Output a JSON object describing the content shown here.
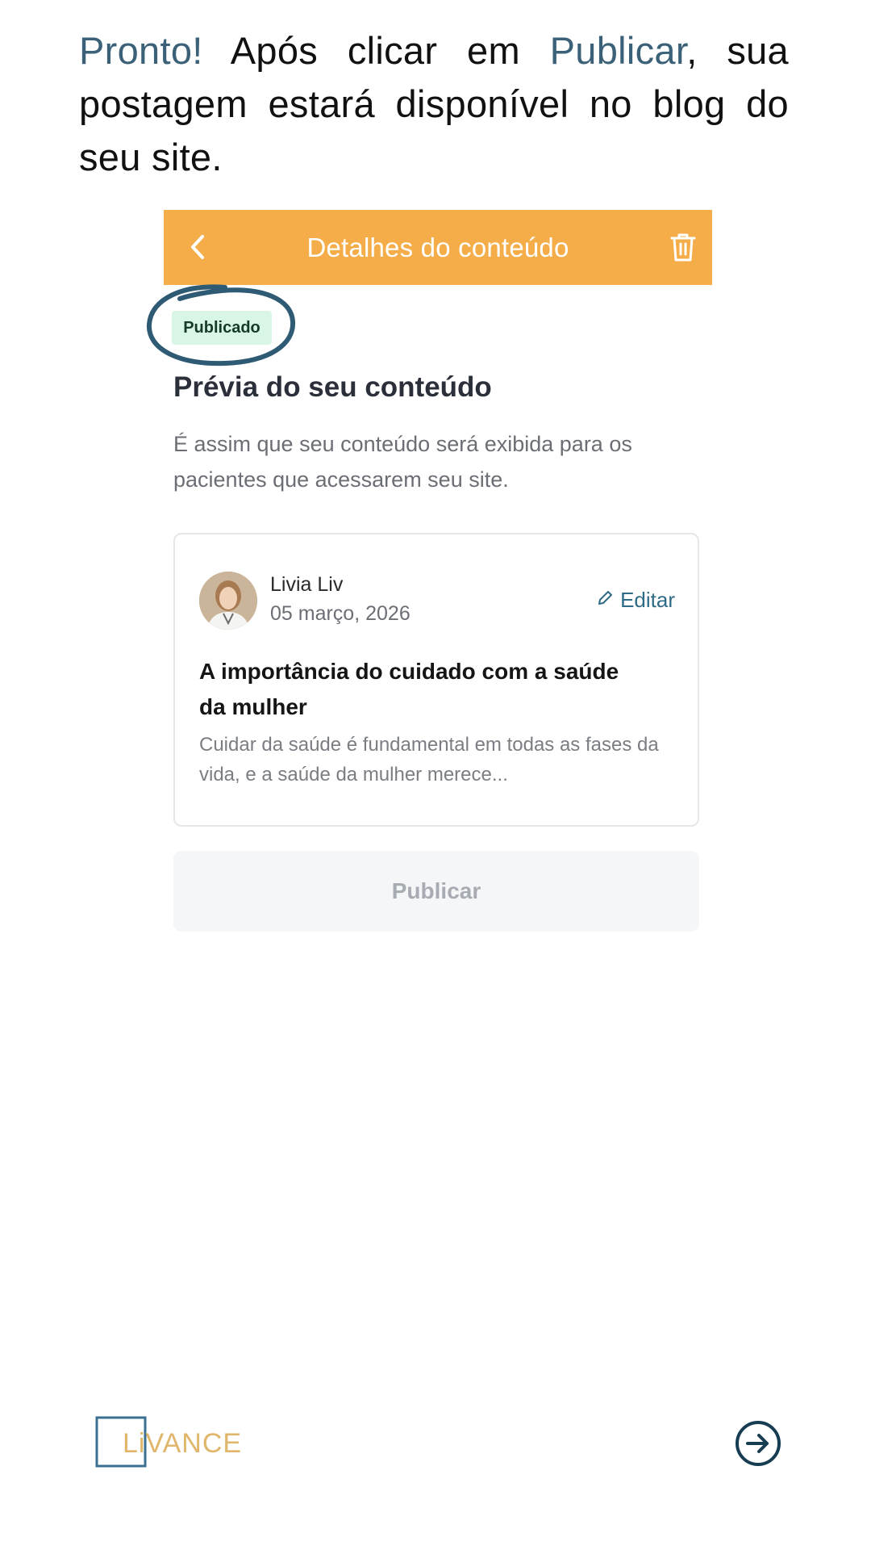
{
  "intro": {
    "pronto": "Pronto!",
    "part1": " Após clicar em ",
    "publicar": "Publicar",
    "part2": ", sua postagem estará disponível no blog do seu site."
  },
  "screen": {
    "header_title": "Detalhes do conteúdo",
    "back_icon": "chevron-left-icon",
    "delete_icon": "trash-icon",
    "status_badge": "Publicado",
    "preview_title": "Prévia do seu conteúdo",
    "preview_description": "É assim que seu conteúdo será exibida para os pacientes que acessarem seu site.",
    "card": {
      "author": "Livia Liv",
      "date": "05 março, 2026",
      "edit_label": "Editar",
      "title": "A importância do cuidado com a saúde da mulher",
      "excerpt": "Cuidar da saúde é fundamental em todas as fases da vida, e a saúde da mulher merece..."
    },
    "publish_button": "Publicar"
  },
  "footer": {
    "logo_text": "LiVANCE",
    "next_icon": "arrow-right-circle-icon"
  },
  "colors": {
    "header": "#f4ad48",
    "accent_text": "#3a6178",
    "badge_bg": "#d8f5e5",
    "link": "#2f6a86",
    "logo_gold": "#e0b66b",
    "logo_blue": "#3a6f92"
  }
}
